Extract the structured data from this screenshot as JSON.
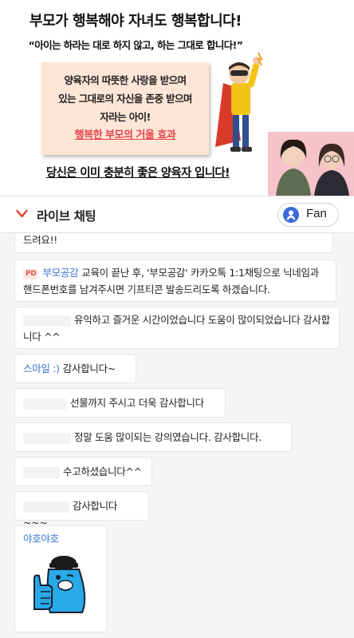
{
  "video": {
    "title": "부모가 행복해야 자녀도 행복합니다!",
    "quote": "“아이는 하라는 대로 하지 않고, 하는 그대로 합니다!”",
    "box_line1": "양육자의 따뜻한 사랑을 받으며",
    "box_line2": "있는 그대로의 자신을 존중 받으며",
    "box_line3": "자라는 아이!",
    "box_highlight": "행복한 부모의 거울 효과",
    "bottom": "당신은 이미 충분히 좋은 양육자 입니다!"
  },
  "header": {
    "title": "라이브 채팅",
    "fan_label": "Fan"
  },
  "colors": {
    "nick": "#3b72d3",
    "pd_badge": "#e15a4a",
    "fan_icon": "#3b6cd9"
  },
  "messages": [
    {
      "nick": "",
      "text": "드려요!!"
    },
    {
      "badge": "PD",
      "nick": "부모공감",
      "text": "교육이 끝난 후, '부모공감' 카카오톡 1:1채팅으로 닉네임과 핸드폰번호를 남겨주시면 기프티콘 발송드리도록 하겠습니다."
    },
    {
      "nick": "",
      "text": "유익하고 즐거운 시간이었습니다 도움이 많이되었습니다 감사합니다 ^^"
    },
    {
      "nick": "스마일 :)",
      "text": "감사합니다~"
    },
    {
      "nick": "",
      "text": "선물까지 주시고 더욱 감사합니다"
    },
    {
      "nick": "",
      "text": "정말 도움 많이되는 강의였습니다. 감사합니다."
    },
    {
      "nick": "",
      "text": "수고하셨습니다^^"
    },
    {
      "nick": "",
      "text": "감사합니다~~~"
    },
    {
      "nick": "야호야호",
      "sticker": "thumbs-up-character-sticker"
    }
  ]
}
